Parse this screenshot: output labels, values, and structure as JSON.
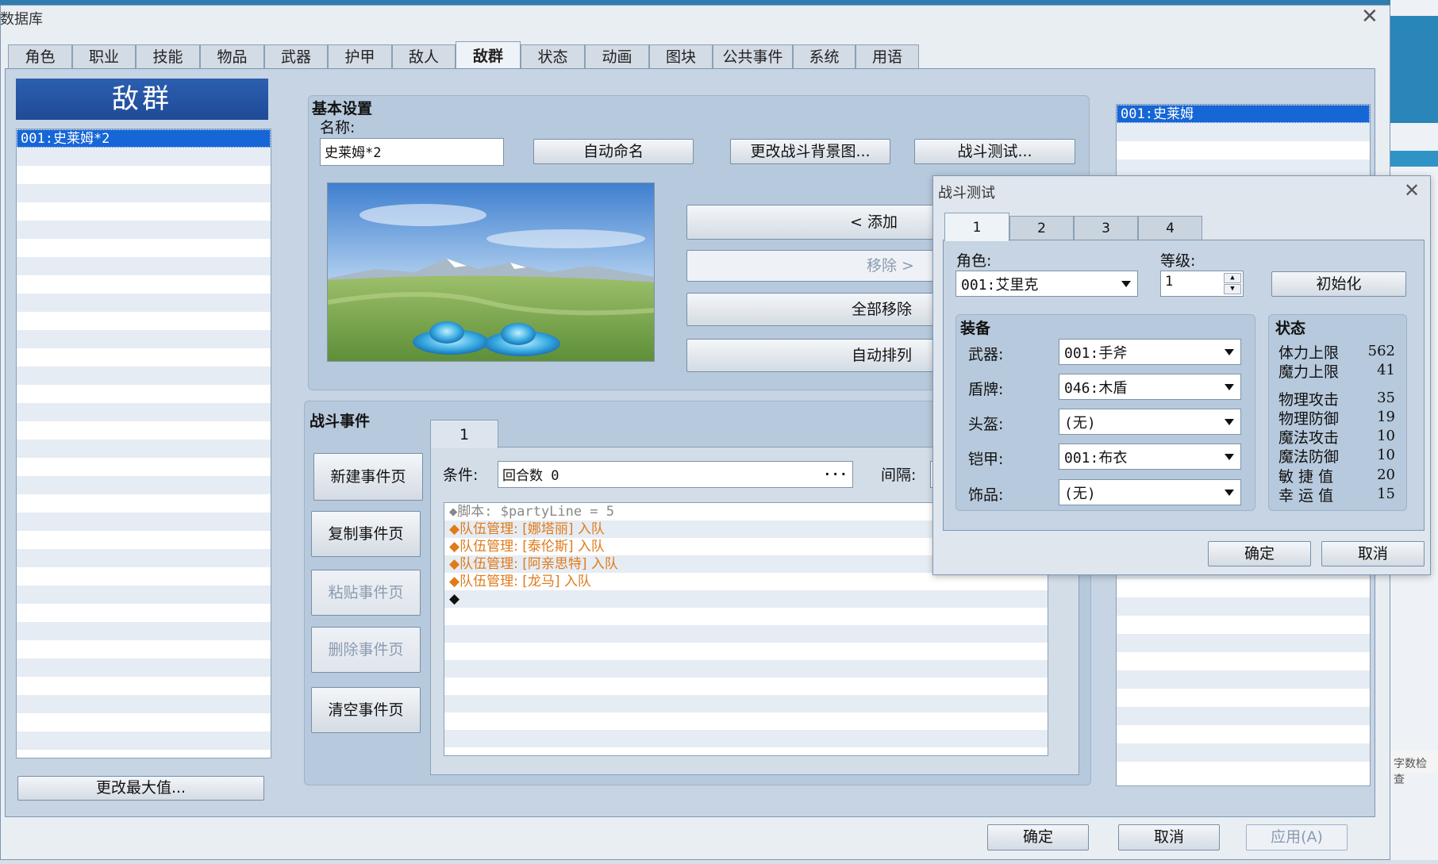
{
  "window": {
    "title": "数据库",
    "close": "✕"
  },
  "tabs": [
    "角色",
    "职业",
    "技能",
    "物品",
    "武器",
    "护甲",
    "敌人",
    "敌群",
    "状态",
    "动画",
    "图块",
    "公共事件",
    "系统",
    "用语"
  ],
  "active_tab": "敌群",
  "troop_list": {
    "header": "敌群",
    "items": [
      "001:史莱姆*2"
    ],
    "change_max_label": "更改最大值..."
  },
  "basic": {
    "caption": "基本设置",
    "name_label": "名称:",
    "name_value": "史莱姆*2",
    "auto_name": "自动命名",
    "change_bg": "更改战斗背景图...",
    "battle_test": "战斗测试...",
    "add": "< 添加",
    "remove": "移除 >",
    "remove_all": "全部移除",
    "arrange": "自动排列"
  },
  "enemies_list": [
    "001:史莱姆"
  ],
  "battle_events": {
    "caption": "战斗事件",
    "buttons": [
      "新建事件页",
      "复制事件页",
      "粘贴事件页",
      "删除事件页",
      "清空事件页"
    ],
    "page_tab": "1",
    "condition_label": "条件:",
    "condition_value": "回合数 0",
    "condition_more": "...",
    "span_label": "间隔:",
    "commands": [
      {
        "text": "◆脚本: $partyLine = 5",
        "kind": "script"
      },
      {
        "text": "◆队伍管理: [娜塔丽] 入队",
        "kind": "party"
      },
      {
        "text": "◆队伍管理: [泰伦斯] 入队",
        "kind": "party"
      },
      {
        "text": "◆队伍管理: [阿亲思特] 入队",
        "kind": "party"
      },
      {
        "text": "◆队伍管理: [龙马] 入队",
        "kind": "party"
      },
      {
        "text": "◆",
        "kind": "empty"
      }
    ]
  },
  "footer": {
    "ok": "确定",
    "cancel": "取消",
    "apply": "应用(A)"
  },
  "background": {
    "side_tag": "字数检查"
  },
  "dialog": {
    "title": "战斗测试",
    "close": "✕",
    "tabs": [
      "1",
      "2",
      "3",
      "4"
    ],
    "actor_label": "角色:",
    "actor_value": "001:艾里克",
    "level_label": "等级:",
    "level_value": "1",
    "init_button": "初始化",
    "equip_caption": "装备",
    "equip": [
      {
        "slot": "武器:",
        "value": "001:手斧"
      },
      {
        "slot": "盾牌:",
        "value": "046:木盾"
      },
      {
        "slot": "头盔:",
        "value": "(无)"
      },
      {
        "slot": "铠甲:",
        "value": "001:布衣"
      },
      {
        "slot": "饰品:",
        "value": "(无)"
      }
    ],
    "status_caption": "状态",
    "stats": [
      {
        "name": "体力上限",
        "value": "562"
      },
      {
        "name": "魔力上限",
        "value": "41"
      },
      {
        "name": "物理攻击",
        "value": "35"
      },
      {
        "name": "物理防御",
        "value": "19"
      },
      {
        "name": "魔法攻击",
        "value": "10"
      },
      {
        "name": "魔法防御",
        "value": "10"
      },
      {
        "name": "敏 捷 值",
        "value": "20"
      },
      {
        "name": "幸 运 值",
        "value": "15"
      }
    ],
    "ok": "确定",
    "cancel": "取消"
  }
}
